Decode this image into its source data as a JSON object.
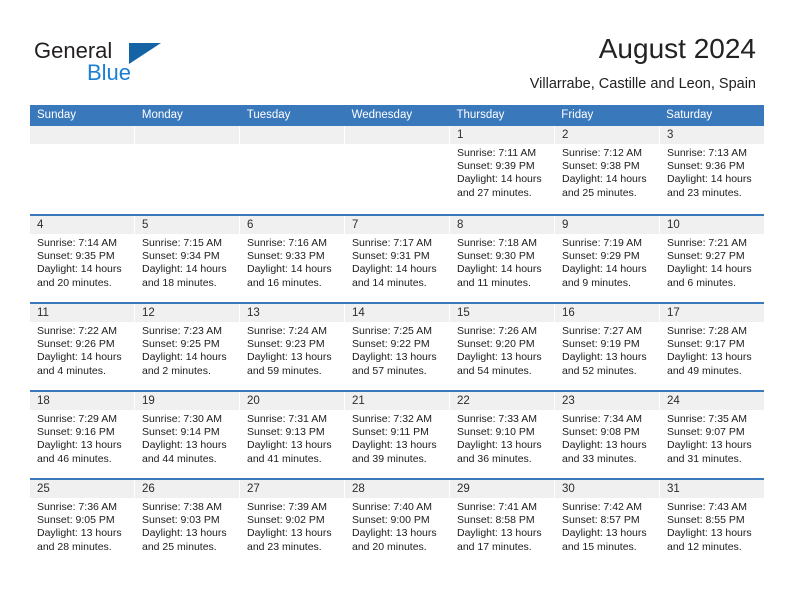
{
  "brand": {
    "name_part1": "General",
    "name_part2": "Blue",
    "accent_color": "#1464a5",
    "blue_text_color": "#1b7fd4",
    "logo_icon": "triangle-flag-icon"
  },
  "header": {
    "month_title": "August 2024",
    "location": "Villarrabe, Castille and Leon, Spain"
  },
  "calendar": {
    "header_bg": "#3a78bc",
    "day_band_bg": "#f0f0f0",
    "weekday_names": [
      "Sunday",
      "Monday",
      "Tuesday",
      "Wednesday",
      "Thursday",
      "Friday",
      "Saturday"
    ],
    "weeks": [
      [
        {
          "day": "",
          "sunrise": "",
          "sunset": "",
          "daylight_line1": "",
          "daylight_line2": ""
        },
        {
          "day": "",
          "sunrise": "",
          "sunset": "",
          "daylight_line1": "",
          "daylight_line2": ""
        },
        {
          "day": "",
          "sunrise": "",
          "sunset": "",
          "daylight_line1": "",
          "daylight_line2": ""
        },
        {
          "day": "",
          "sunrise": "",
          "sunset": "",
          "daylight_line1": "",
          "daylight_line2": ""
        },
        {
          "day": "1",
          "sunrise": "Sunrise: 7:11 AM",
          "sunset": "Sunset: 9:39 PM",
          "daylight_line1": "Daylight: 14 hours",
          "daylight_line2": "and 27 minutes."
        },
        {
          "day": "2",
          "sunrise": "Sunrise: 7:12 AM",
          "sunset": "Sunset: 9:38 PM",
          "daylight_line1": "Daylight: 14 hours",
          "daylight_line2": "and 25 minutes."
        },
        {
          "day": "3",
          "sunrise": "Sunrise: 7:13 AM",
          "sunset": "Sunset: 9:36 PM",
          "daylight_line1": "Daylight: 14 hours",
          "daylight_line2": "and 23 minutes."
        }
      ],
      [
        {
          "day": "4",
          "sunrise": "Sunrise: 7:14 AM",
          "sunset": "Sunset: 9:35 PM",
          "daylight_line1": "Daylight: 14 hours",
          "daylight_line2": "and 20 minutes."
        },
        {
          "day": "5",
          "sunrise": "Sunrise: 7:15 AM",
          "sunset": "Sunset: 9:34 PM",
          "daylight_line1": "Daylight: 14 hours",
          "daylight_line2": "and 18 minutes."
        },
        {
          "day": "6",
          "sunrise": "Sunrise: 7:16 AM",
          "sunset": "Sunset: 9:33 PM",
          "daylight_line1": "Daylight: 14 hours",
          "daylight_line2": "and 16 minutes."
        },
        {
          "day": "7",
          "sunrise": "Sunrise: 7:17 AM",
          "sunset": "Sunset: 9:31 PM",
          "daylight_line1": "Daylight: 14 hours",
          "daylight_line2": "and 14 minutes."
        },
        {
          "day": "8",
          "sunrise": "Sunrise: 7:18 AM",
          "sunset": "Sunset: 9:30 PM",
          "daylight_line1": "Daylight: 14 hours",
          "daylight_line2": "and 11 minutes."
        },
        {
          "day": "9",
          "sunrise": "Sunrise: 7:19 AM",
          "sunset": "Sunset: 9:29 PM",
          "daylight_line1": "Daylight: 14 hours",
          "daylight_line2": "and 9 minutes."
        },
        {
          "day": "10",
          "sunrise": "Sunrise: 7:21 AM",
          "sunset": "Sunset: 9:27 PM",
          "daylight_line1": "Daylight: 14 hours",
          "daylight_line2": "and 6 minutes."
        }
      ],
      [
        {
          "day": "11",
          "sunrise": "Sunrise: 7:22 AM",
          "sunset": "Sunset: 9:26 PM",
          "daylight_line1": "Daylight: 14 hours",
          "daylight_line2": "and 4 minutes."
        },
        {
          "day": "12",
          "sunrise": "Sunrise: 7:23 AM",
          "sunset": "Sunset: 9:25 PM",
          "daylight_line1": "Daylight: 14 hours",
          "daylight_line2": "and 2 minutes."
        },
        {
          "day": "13",
          "sunrise": "Sunrise: 7:24 AM",
          "sunset": "Sunset: 9:23 PM",
          "daylight_line1": "Daylight: 13 hours",
          "daylight_line2": "and 59 minutes."
        },
        {
          "day": "14",
          "sunrise": "Sunrise: 7:25 AM",
          "sunset": "Sunset: 9:22 PM",
          "daylight_line1": "Daylight: 13 hours",
          "daylight_line2": "and 57 minutes."
        },
        {
          "day": "15",
          "sunrise": "Sunrise: 7:26 AM",
          "sunset": "Sunset: 9:20 PM",
          "daylight_line1": "Daylight: 13 hours",
          "daylight_line2": "and 54 minutes."
        },
        {
          "day": "16",
          "sunrise": "Sunrise: 7:27 AM",
          "sunset": "Sunset: 9:19 PM",
          "daylight_line1": "Daylight: 13 hours",
          "daylight_line2": "and 52 minutes."
        },
        {
          "day": "17",
          "sunrise": "Sunrise: 7:28 AM",
          "sunset": "Sunset: 9:17 PM",
          "daylight_line1": "Daylight: 13 hours",
          "daylight_line2": "and 49 minutes."
        }
      ],
      [
        {
          "day": "18",
          "sunrise": "Sunrise: 7:29 AM",
          "sunset": "Sunset: 9:16 PM",
          "daylight_line1": "Daylight: 13 hours",
          "daylight_line2": "and 46 minutes."
        },
        {
          "day": "19",
          "sunrise": "Sunrise: 7:30 AM",
          "sunset": "Sunset: 9:14 PM",
          "daylight_line1": "Daylight: 13 hours",
          "daylight_line2": "and 44 minutes."
        },
        {
          "day": "20",
          "sunrise": "Sunrise: 7:31 AM",
          "sunset": "Sunset: 9:13 PM",
          "daylight_line1": "Daylight: 13 hours",
          "daylight_line2": "and 41 minutes."
        },
        {
          "day": "21",
          "sunrise": "Sunrise: 7:32 AM",
          "sunset": "Sunset: 9:11 PM",
          "daylight_line1": "Daylight: 13 hours",
          "daylight_line2": "and 39 minutes."
        },
        {
          "day": "22",
          "sunrise": "Sunrise: 7:33 AM",
          "sunset": "Sunset: 9:10 PM",
          "daylight_line1": "Daylight: 13 hours",
          "daylight_line2": "and 36 minutes."
        },
        {
          "day": "23",
          "sunrise": "Sunrise: 7:34 AM",
          "sunset": "Sunset: 9:08 PM",
          "daylight_line1": "Daylight: 13 hours",
          "daylight_line2": "and 33 minutes."
        },
        {
          "day": "24",
          "sunrise": "Sunrise: 7:35 AM",
          "sunset": "Sunset: 9:07 PM",
          "daylight_line1": "Daylight: 13 hours",
          "daylight_line2": "and 31 minutes."
        }
      ],
      [
        {
          "day": "25",
          "sunrise": "Sunrise: 7:36 AM",
          "sunset": "Sunset: 9:05 PM",
          "daylight_line1": "Daylight: 13 hours",
          "daylight_line2": "and 28 minutes."
        },
        {
          "day": "26",
          "sunrise": "Sunrise: 7:38 AM",
          "sunset": "Sunset: 9:03 PM",
          "daylight_line1": "Daylight: 13 hours",
          "daylight_line2": "and 25 minutes."
        },
        {
          "day": "27",
          "sunrise": "Sunrise: 7:39 AM",
          "sunset": "Sunset: 9:02 PM",
          "daylight_line1": "Daylight: 13 hours",
          "daylight_line2": "and 23 minutes."
        },
        {
          "day": "28",
          "sunrise": "Sunrise: 7:40 AM",
          "sunset": "Sunset: 9:00 PM",
          "daylight_line1": "Daylight: 13 hours",
          "daylight_line2": "and 20 minutes."
        },
        {
          "day": "29",
          "sunrise": "Sunrise: 7:41 AM",
          "sunset": "Sunset: 8:58 PM",
          "daylight_line1": "Daylight: 13 hours",
          "daylight_line2": "and 17 minutes."
        },
        {
          "day": "30",
          "sunrise": "Sunrise: 7:42 AM",
          "sunset": "Sunset: 8:57 PM",
          "daylight_line1": "Daylight: 13 hours",
          "daylight_line2": "and 15 minutes."
        },
        {
          "day": "31",
          "sunrise": "Sunrise: 7:43 AM",
          "sunset": "Sunset: 8:55 PM",
          "daylight_line1": "Daylight: 13 hours",
          "daylight_line2": "and 12 minutes."
        }
      ]
    ]
  }
}
